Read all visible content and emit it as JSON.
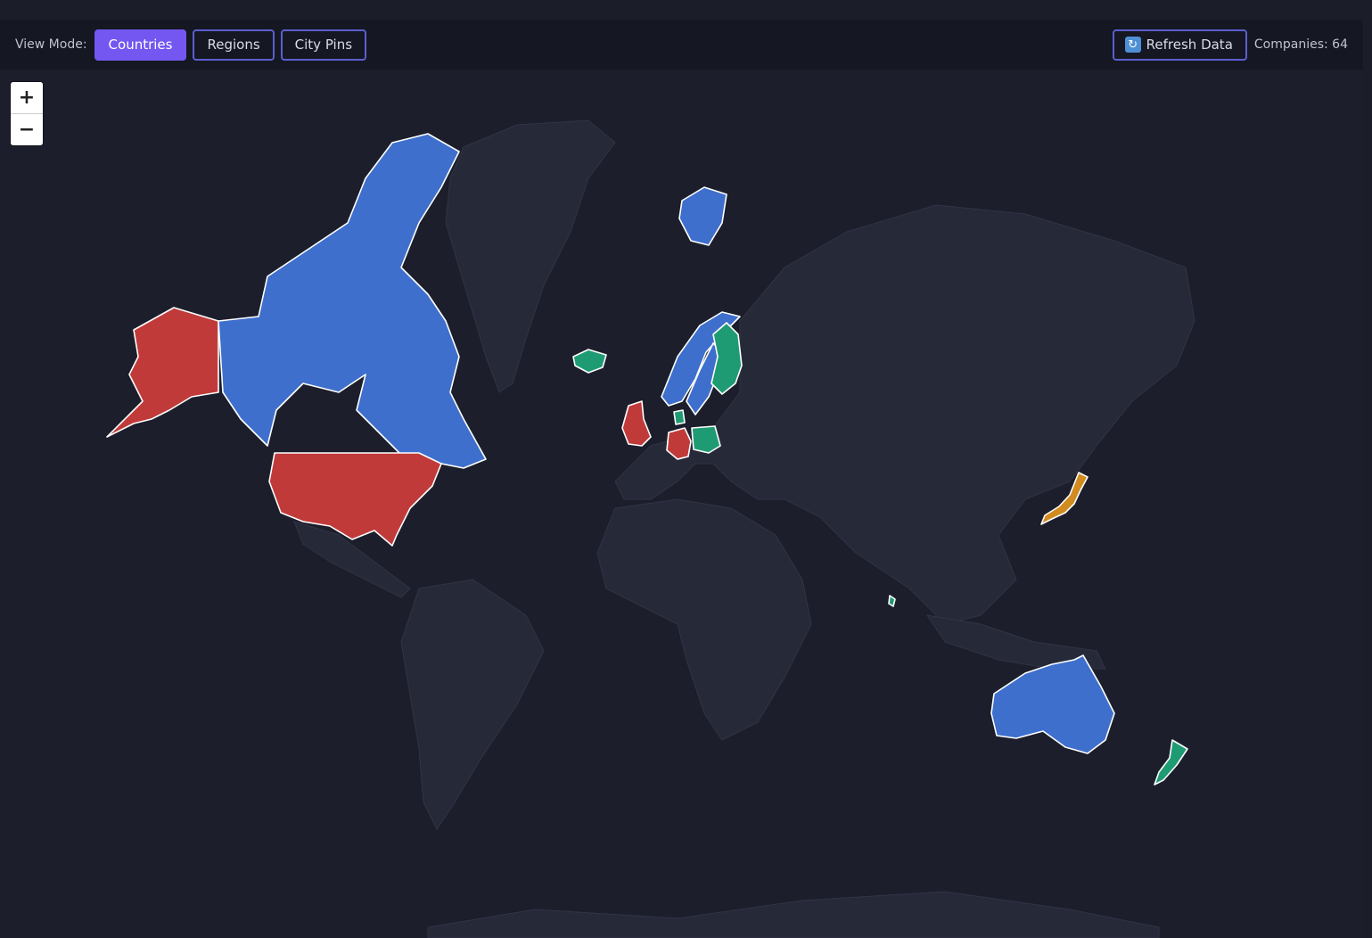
{
  "toolbar": {
    "view_mode_label": "View Mode:",
    "modes": [
      {
        "label": "Countries",
        "active": true
      },
      {
        "label": "Regions",
        "active": false
      },
      {
        "label": "City Pins",
        "active": false
      }
    ],
    "refresh_label": "Refresh Data",
    "refresh_icon": "refresh-icon",
    "companies_label": "Companies: 64"
  },
  "zoom": {
    "in_label": "+",
    "out_label": "−"
  },
  "colors": {
    "background": "#1c1e2b",
    "land": "#262938",
    "active_button": "#7357f0",
    "button_border": "#5b5fcf",
    "highlight_blue": "#3e6fcc",
    "highlight_red": "#c13a3a",
    "highlight_green": "#1f9b73",
    "highlight_orange": "#d18b1f"
  },
  "map": {
    "highlighted_countries": [
      {
        "country": "Canada",
        "color": "#3e6fcc"
      },
      {
        "country": "United States",
        "color": "#c13a3a"
      },
      {
        "country": "Alaska (United States)",
        "color": "#c13a3a"
      },
      {
        "country": "Norway",
        "color": "#3e6fcc"
      },
      {
        "country": "Sweden",
        "color": "#3e6fcc"
      },
      {
        "country": "Finland",
        "color": "#1f9b73"
      },
      {
        "country": "Iceland",
        "color": "#1f9b73"
      },
      {
        "country": "United Kingdom",
        "color": "#c13a3a"
      },
      {
        "country": "Germany",
        "color": "#c13a3a"
      },
      {
        "country": "Poland",
        "color": "#1f9b73"
      },
      {
        "country": "Denmark",
        "color": "#1f9b73"
      },
      {
        "country": "Svalbard (Norway)",
        "color": "#3e6fcc"
      },
      {
        "country": "Japan",
        "color": "#d18b1f"
      },
      {
        "country": "Sri Lanka",
        "color": "#1f9b73"
      },
      {
        "country": "Australia",
        "color": "#3e6fcc"
      },
      {
        "country": "New Zealand",
        "color": "#1f9b73"
      }
    ]
  }
}
